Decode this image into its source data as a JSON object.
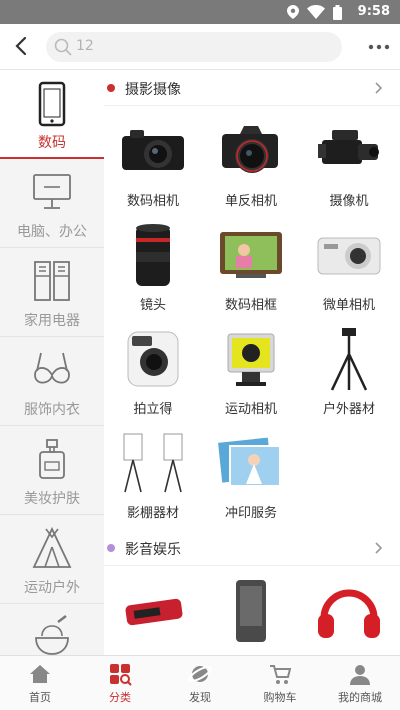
{
  "status_bar": {
    "time": "9:58",
    "icons": [
      "location-icon",
      "wifi-icon",
      "battery-icon"
    ]
  },
  "header": {
    "search_text": "12"
  },
  "sidebar": {
    "items": [
      {
        "label": "数码",
        "icon": "phone-icon",
        "active": true
      },
      {
        "label": "电脑、办公",
        "icon": "monitor-icon"
      },
      {
        "label": "家用电器",
        "icon": "fridge-icon"
      },
      {
        "label": "服饰内衣",
        "icon": "bra-icon"
      },
      {
        "label": "美妆护肤",
        "icon": "perfume-icon"
      },
      {
        "label": "运动户外",
        "icon": "tent-icon"
      },
      {
        "label": "",
        "icon": "mortar-icon"
      }
    ]
  },
  "main": {
    "sections": [
      {
        "title": "摄影摄像",
        "dot_color": "#c8312f",
        "items": [
          "数码相机",
          "单反相机",
          "摄像机",
          "镜头",
          "数码相框",
          "微单相机",
          "拍立得",
          "运动相机",
          "户外器材",
          "影棚器材",
          "冲印服务"
        ]
      },
      {
        "title": "影音娱乐",
        "dot_color": "#b48fd8",
        "items": [
          "",
          "",
          ""
        ]
      }
    ]
  },
  "bottom_nav": {
    "tabs": [
      {
        "label": "首页",
        "icon": "home-icon"
      },
      {
        "label": "分类",
        "icon": "category-icon",
        "active": true
      },
      {
        "label": "发现",
        "icon": "planet-icon"
      },
      {
        "label": "购物车",
        "icon": "cart-icon"
      },
      {
        "label": "我的商城",
        "icon": "user-icon"
      }
    ]
  },
  "colors": {
    "accent": "#c8312f",
    "status_bar": "#7a7a7a"
  }
}
